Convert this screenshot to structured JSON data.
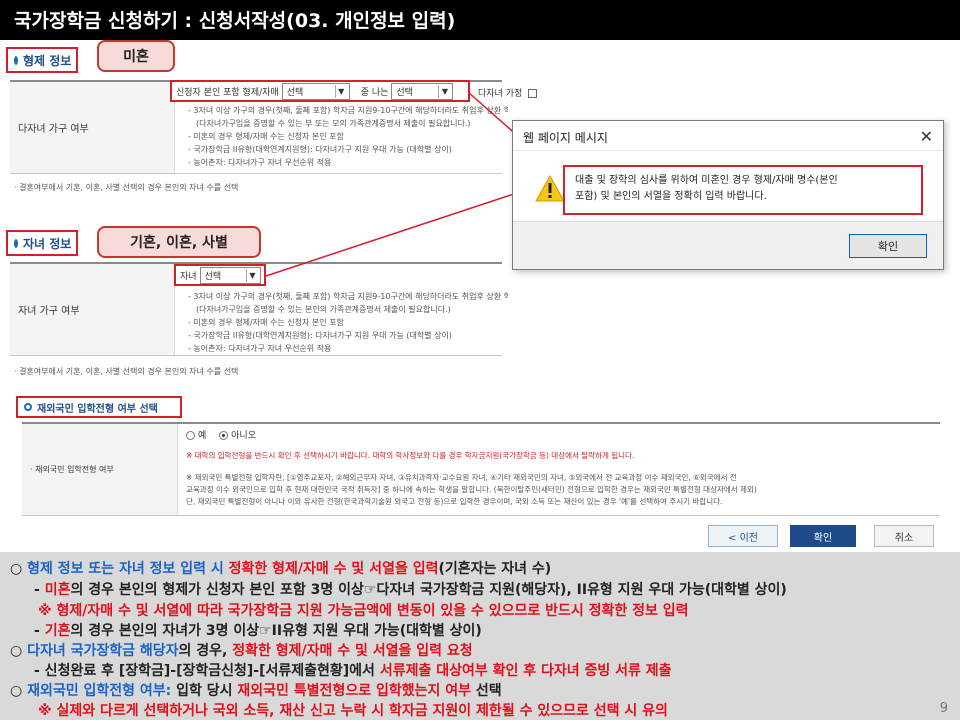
{
  "title": "국가장학금 신청하기 : 신청서작성(03. 개인정보 입력)",
  "sibling_section": {
    "header": "형제 정보",
    "callout": "미혼",
    "row_label": "다자녀 가구 여부",
    "select_prefix": "신청자 본인 포함 형제/자매",
    "select1_value": "선택",
    "middle_text": "중 나는",
    "select2_value": "선택",
    "checkbox_label": "다자녀 가정",
    "notes": [
      "- 3자녀 이상 가구의 경우(첫째, 둘째 포함) 학자금 지원9-10구간에 해당하더라도 취업후 상환 학자금대출 이용 가능",
      "(다자녀가구임을 증명할 수 있는 부 또는 모의 가족관계증명서 제출이 필요합니다.)",
      "- 미혼의 경우 형제/자매 수는 신청자 본인 포함",
      "- 국가장학금 II유형(대학연계지원형): 다자녀가구 지원 우대 가능 (대학별 상이)",
      "- 농어촌자: 다자녀가구 자녀 우선순위 적용"
    ],
    "footnote": "· 결혼여부에서 기혼, 이혼, 사별 선택의 경우 본인의 자녀 수를 선택"
  },
  "child_section": {
    "header": "자녀 정보",
    "callout": "기혼, 이혼, 사별",
    "row_label": "자녀 가구 여부",
    "select_prefix": "자녀",
    "select_value": "선택",
    "notes": [
      "- 3자녀 이상 가구의 경우(첫째, 둘째 포함) 학자금 지원9-10구간에 해당하더라도 취업후 상환 학자금대출 이용 가능",
      "(다자녀가구임을 증명할 수 있는 본인의 가족관계증명서 제출이 필요합니다.)",
      "- 미혼의 경우 형제/자매 수는 신청자 본인 포함",
      "- 국가장학금 II유형(대학연계지원형): 다자녀가구 지원 우대 가능 (대학별 상이)",
      "- 농어촌자: 다자녀가구 자녀 우선순위 적용"
    ],
    "footnote": "· 결혼여부에서 기혼, 이혼, 사별 선택의 경우 본인의 자녀 수를 선택"
  },
  "overseas_section": {
    "header": "재외국민 입학전형 여부 선택",
    "row_label": "· 재외국민 입학전형 여부",
    "radio_yes": "예",
    "radio_no": "아니오",
    "red_notice": "※ 대학의 입학전형을 반드시 확인 후 선택하시기 바랍니다. 대학의 학사정보와 다를 경우 학자금지원(국가장학금 등) 대상에서 탈락하게 됩니다.",
    "notes": [
      "※ 재외국민 특별전형 입학자란, [①영주교포자, ②해외근무자 자녀, ③유치과학자·교수요원 자녀, ④기타 재외국민의 자녀, ⑤외국에서 전 교육과정 이수 재외국민, ⑥외국에서 전",
      "교육과정 이수 외국인으로 입학 후 현재 대한민국 국적 취득자] 중 하나에 속하는 학생을 말합니다. (북한이탈주민(새터민) 전형으로 입학한 경우는 재외국민 특별전형 대상자에서 제외)",
      "단, 재외국민 특별전형이 아니나 이와 유사한 전형(한국과학기술원 외국고 전형 등)으로 입학한 경우이며, 국외 소득 또는 재산이 있는 경우 '예'를 선택하여 주시기 바랍니다."
    ]
  },
  "dialog": {
    "title": "웹 페이지 메시지",
    "message_line1": "대출 및 장학의 심사를 위하여 미혼인 경우 형제/자매 명수(본인",
    "message_line2": "포함) 및 본인의 서열을 정확히 입력 바랍니다.",
    "ok_label": "확인"
  },
  "nav": {
    "prev_label": "< 이전",
    "confirm_label": "확인",
    "cancel_label": "취소"
  },
  "bottom": {
    "l1_a": "○ ",
    "l1_b": "형제 정보 또는 자녀 정보 입력 시 ",
    "l1_c": "정확한 형제/자매 수 및 서열을 입력",
    "l1_d": "(기혼자는 자녀 수)",
    "l2_a": "- ",
    "l2_b": "미혼",
    "l2_c": "의 경우 본인의 형제가 신청자 본인 포함 3명 이상☞다자녀 국가장학금 지원(해당자), II유형 지원 우대 가능(대학별 상이)",
    "l3": "※ 형제/자매 수 및 서열에 따라 국가장학금 지원 가능금액에 변동이 있을 수 있으므로 반드시 정확한 정보 입력",
    "l4_a": "- ",
    "l4_b": "기혼",
    "l4_c": "의 경우 본인의 자녀가 3명 이상☞II유형 지원 우대 가능(대학별 상이)",
    "l5_a": "○ ",
    "l5_b": "다자녀 국가장학금 해당자",
    "l5_c": "의 경우, ",
    "l5_d": "정확한 형제/자매 수 및 서열을 입력 요청",
    "l6_a": "- 신청완료 후 [장학금]-[장학금신청]-[서류제출현황]에서 ",
    "l6_b": "서류제출 대상여부 확인 후 다자녀 증빙 서류 제출",
    "l7_a": "○ ",
    "l7_b": "재외국민 입학전형 여부: ",
    "l7_c": "입학 당시 ",
    "l7_d": "재외국민 특별전형으로 입학했는지 여부",
    "l7_e": " 선택",
    "l8": "※ 실제와 다르게 선택하거나 국외 소득, 재산 신고 누락 시 학자금 지원이 제한될 수 있으므로 선택 시 유의",
    "page_number": "9"
  }
}
